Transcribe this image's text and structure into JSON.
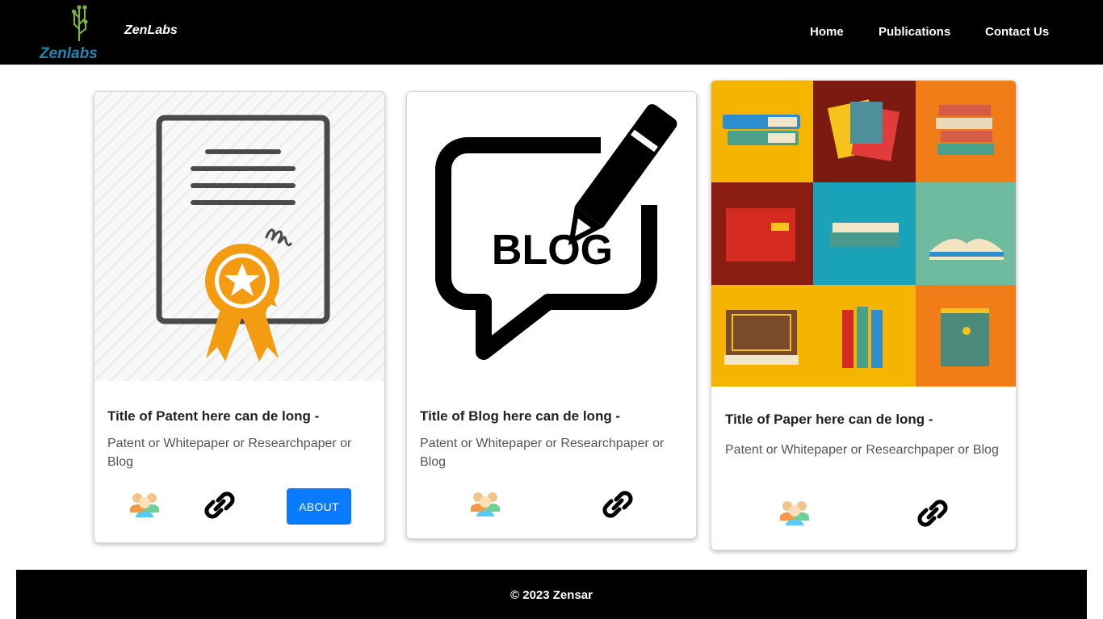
{
  "header": {
    "logo_text": "Zenlabs",
    "brand": "ZenLabs",
    "nav": {
      "home": "Home",
      "publications": "Publications",
      "contact": "Contact Us"
    }
  },
  "cards": [
    {
      "image": "patent-certificate-illustration",
      "title": "Title of Patent here can de long -",
      "text": "Patent or Whitepaper or Researchpaper or Blog",
      "button": "ABOUT"
    },
    {
      "image": "blog-speech-bubble-pencil-illustration",
      "image_text": "BLOG",
      "title": "Title of Blog here can de long -",
      "text": "Patent or Whitepaper or Researchpaper or Blog"
    },
    {
      "image": "books-grid-illustration",
      "title": "Title of Paper here can de long -",
      "text": "Patent or Whitepaper or Researchpaper or Blog"
    }
  ],
  "icons": {
    "authors": "people-icon",
    "link": "link-icon"
  },
  "colors": {
    "header_bg": "#000000",
    "button": "#0a7bff",
    "badge": "#f39c12"
  },
  "footer": {
    "copyright": "© 2023 Zensar"
  }
}
